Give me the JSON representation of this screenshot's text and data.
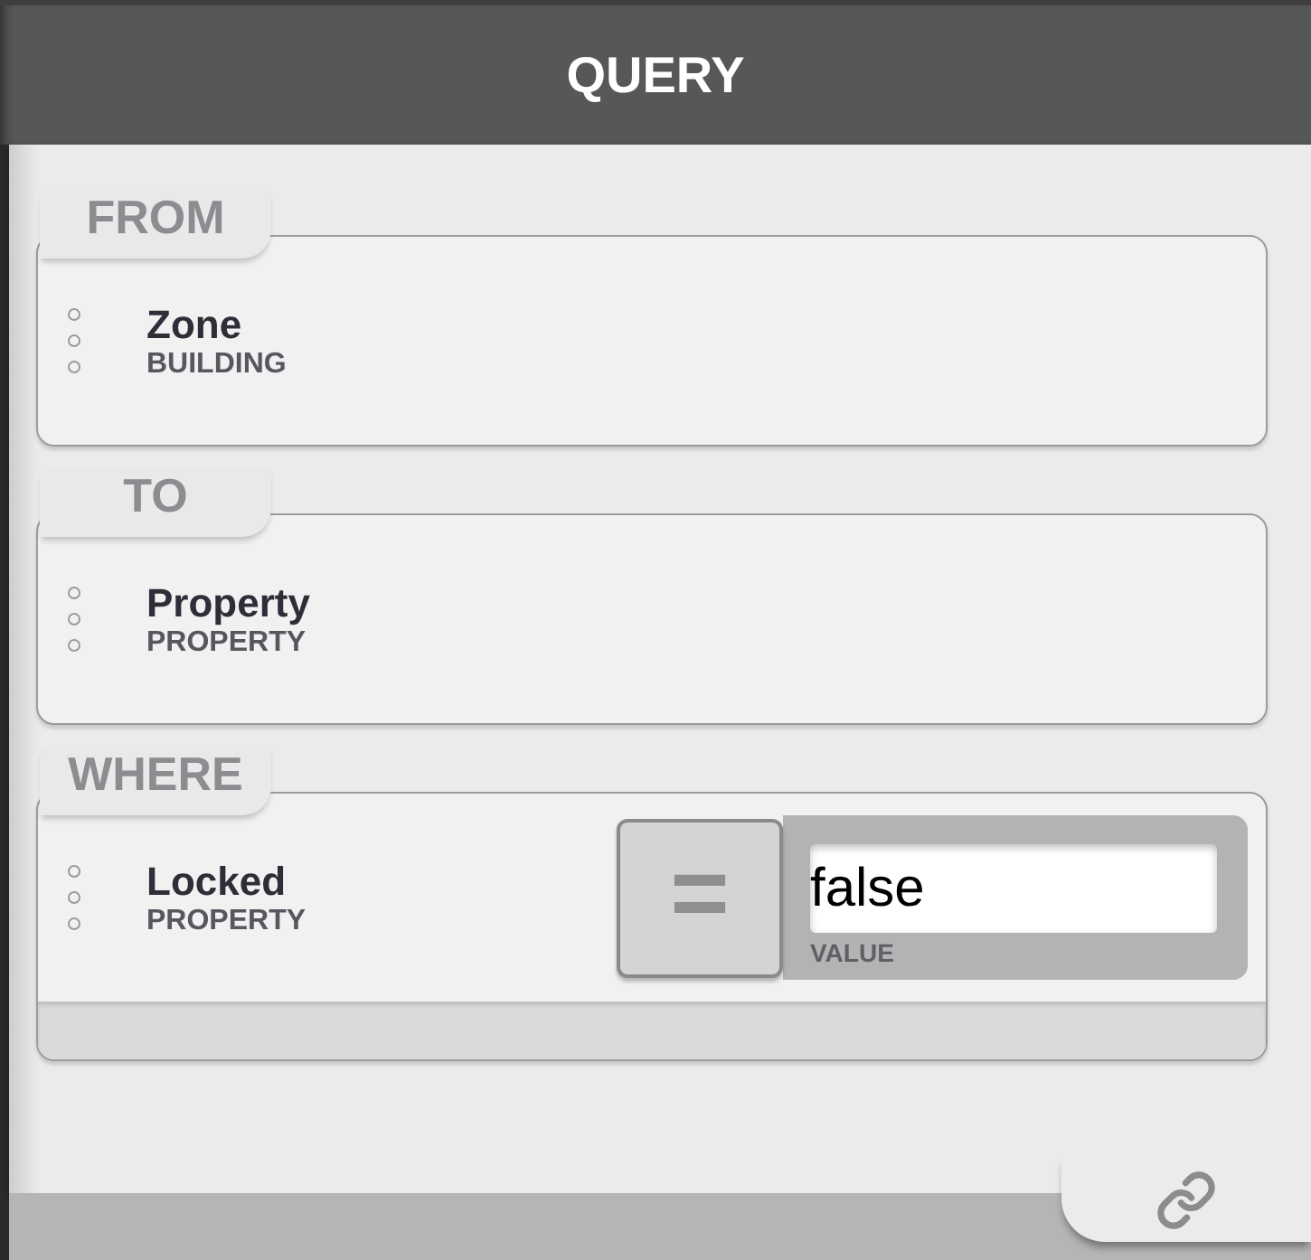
{
  "window": {
    "title": "QUERY"
  },
  "sections": [
    {
      "label": "FROM",
      "kind": "clause",
      "items": [
        {
          "name": "Zone",
          "type": "BUILDING"
        }
      ]
    },
    {
      "label": "TO",
      "kind": "clause",
      "items": [
        {
          "name": "Property",
          "type": "PROPERTY"
        }
      ]
    },
    {
      "label": "WHERE",
      "kind": "filter",
      "items": [
        {
          "name": "Locked",
          "type": "PROPERTY",
          "condition": {
            "operator": "=",
            "value": "false",
            "value_label": "VALUE"
          }
        }
      ]
    }
  ]
}
